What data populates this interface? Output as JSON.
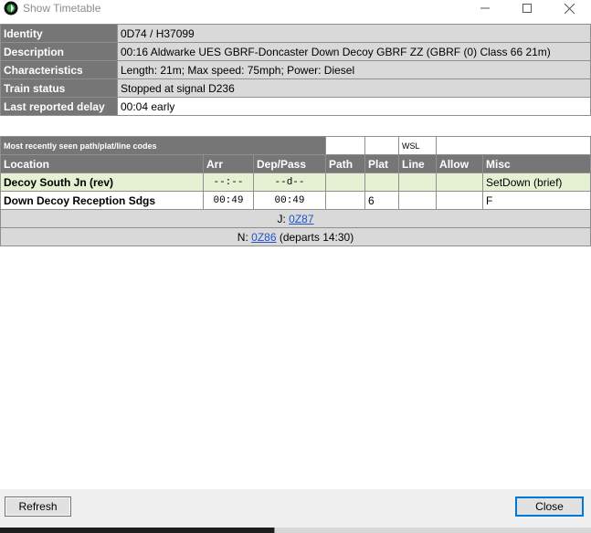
{
  "window": {
    "title": "Show Timetable",
    "minimize_glyph": "—",
    "maximize_glyph": "☐",
    "close_glyph": "✕"
  },
  "info": [
    {
      "label": "Identity",
      "value": "0D74 / H37099"
    },
    {
      "label": "Description",
      "value": "00:16 Aldwarke UES GBRF-Doncaster Down Decoy GBRF ZZ (GBRF (0) Class 66 21m)"
    },
    {
      "label": "Characteristics",
      "value": "Length: 21m; Max speed: 75mph; Power: Diesel"
    },
    {
      "label": "Train status",
      "value": "Stopped at signal D236"
    },
    {
      "label": "Last reported delay",
      "value": "00:04 early"
    }
  ],
  "codes": {
    "label": "Most recently seen path/plat/line codes",
    "path": "",
    "plat": "",
    "line": "WSL",
    "rest": ""
  },
  "columns": {
    "location": "Location",
    "arr": "Arr",
    "dep": "Dep/Pass",
    "path": "Path",
    "plat": "Plat",
    "line": "Line",
    "allow": "Allow",
    "misc": "Misc"
  },
  "rows": [
    {
      "location": "Decoy South Jn (rev)",
      "arr": "--:--",
      "dep": "--d--",
      "path": "",
      "plat": "",
      "line": "",
      "allow": "",
      "misc": "SetDown (brief)"
    },
    {
      "location": "Down Decoy Reception Sdgs",
      "arr": "00:49",
      "dep": "00:49",
      "path": "",
      "plat": "6",
      "line": "",
      "allow": "",
      "misc": "F"
    }
  ],
  "joins": {
    "j_prefix": "J: ",
    "j_link": "0Z87",
    "n_prefix": "N: ",
    "n_link": "0Z86",
    "n_suffix": " (departs 14:30)"
  },
  "buttons": {
    "refresh": "Refresh",
    "close": "Close"
  },
  "colors": {
    "header_bg": "#767676",
    "value_bg": "#d9d9d9",
    "highlight_row": "#e6f0d2",
    "link": "#1f55c8"
  }
}
